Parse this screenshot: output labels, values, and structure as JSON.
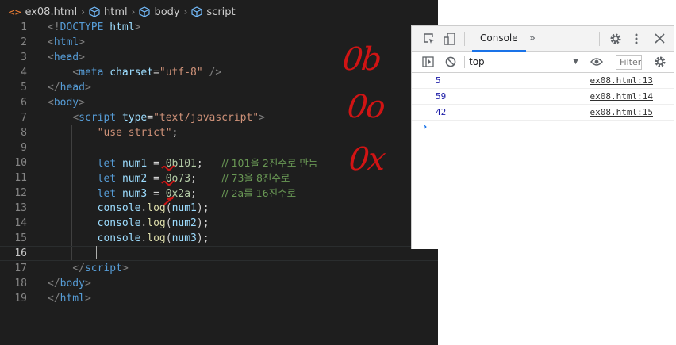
{
  "breadcrumb": {
    "file": "ex08.html",
    "items": [
      "html",
      "body",
      "script"
    ]
  },
  "editor": {
    "line_numbers": [
      "1",
      "2",
      "3",
      "4",
      "5",
      "6",
      "7",
      "8",
      "9",
      "10",
      "11",
      "12",
      "13",
      "14",
      "15",
      "16",
      "17",
      "18",
      "19"
    ],
    "comments": {
      "num1": "// 101을 2진수로 만듬",
      "num2": "// 73을 8진수로",
      "num3": "// 2a를 16진수로"
    }
  },
  "annotations": {
    "binary": "0b",
    "octal": "0o",
    "hex": "0x"
  },
  "devtools": {
    "tab_label": "Console",
    "more_tabs": "»",
    "context": "top",
    "filter_placeholder": "Filter",
    "logs": [
      {
        "value": "5",
        "source": "ex08.html:13"
      },
      {
        "value": "59",
        "source": "ex08.html:14"
      },
      {
        "value": "42",
        "source": "ex08.html:15"
      }
    ],
    "prompt": "›"
  },
  "colors": {
    "editor_bg": "#1e1e1e",
    "annotation_red": "#d11414",
    "console_number": "#1a1aa6",
    "accent": "#1a73e8"
  }
}
